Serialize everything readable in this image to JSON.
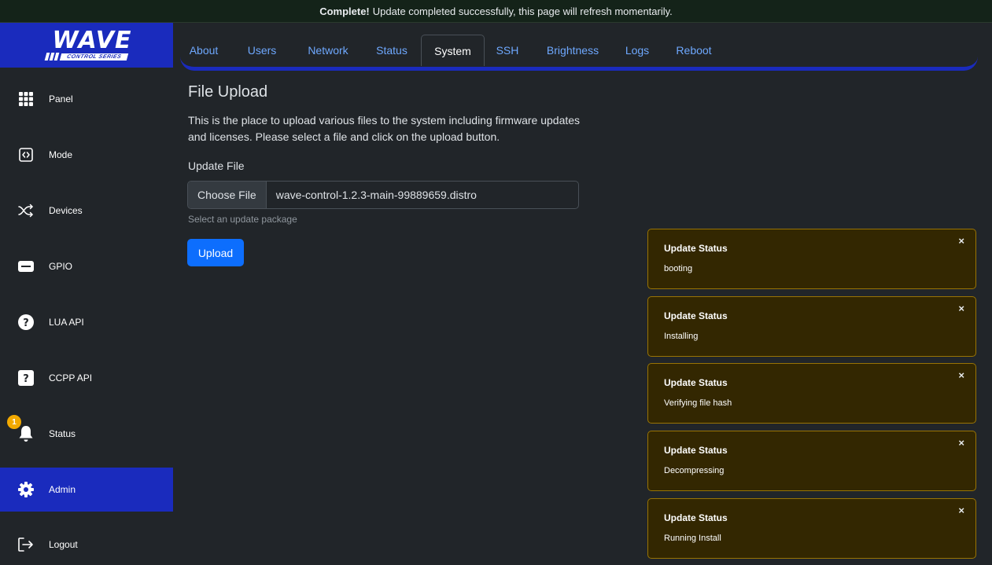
{
  "banner": {
    "bold": "Complete!",
    "text": "Update completed successfully, this page will refresh momentarily."
  },
  "logo": {
    "word": "WAVE",
    "sub": "CONTROL SERIES"
  },
  "sidebar": {
    "items": [
      {
        "label": "Panel",
        "icon": "grid-icon"
      },
      {
        "label": "Mode",
        "icon": "code-square-icon"
      },
      {
        "label": "Devices",
        "icon": "shuffle-icon"
      },
      {
        "label": "GPIO",
        "icon": "gpio-bar-icon"
      },
      {
        "label": "LUA API",
        "icon": "question-circle-icon"
      },
      {
        "label": "CCPP API",
        "icon": "question-square-icon"
      },
      {
        "label": "Status",
        "icon": "bell-icon",
        "badge": "1"
      },
      {
        "label": "Admin",
        "icon": "gear-icon",
        "active": true
      },
      {
        "label": "Logout",
        "icon": "logout-icon"
      }
    ]
  },
  "tabs": [
    {
      "label": "About"
    },
    {
      "label": "Users"
    },
    {
      "label": "Network"
    },
    {
      "label": "Status"
    },
    {
      "label": "System",
      "active": true
    },
    {
      "label": "SSH"
    },
    {
      "label": "Brightness"
    },
    {
      "label": "Logs"
    },
    {
      "label": "Reboot"
    }
  ],
  "main": {
    "title": "File Upload",
    "description": "This is the place to upload various files to the system including firmware updates and licenses. Please select a file and click on the upload button.",
    "field_label": "Update File",
    "choose_file_label": "Choose File",
    "file_name": "wave-control-1.2.3-main-99889659.distro",
    "help_text": "Select an update package",
    "upload_label": "Upload"
  },
  "toasts": [
    {
      "title": "Update Status",
      "body": "booting",
      "close": "×"
    },
    {
      "title": "Update Status",
      "body": "Installing",
      "close": "×"
    },
    {
      "title": "Update Status",
      "body": "Verifying file hash",
      "close": "×"
    },
    {
      "title": "Update Status",
      "body": "Decompressing",
      "close": "×"
    },
    {
      "title": "Update Status",
      "body": "Running Install",
      "close": "×"
    }
  ],
  "colors": {
    "brand_blue": "#1a2bbd",
    "link_blue": "#6ea8fe",
    "primary_button": "#0d6efd",
    "toast_bg": "#332701",
    "toast_border": "#997404",
    "badge": "#f2a900",
    "background": "#212529"
  }
}
